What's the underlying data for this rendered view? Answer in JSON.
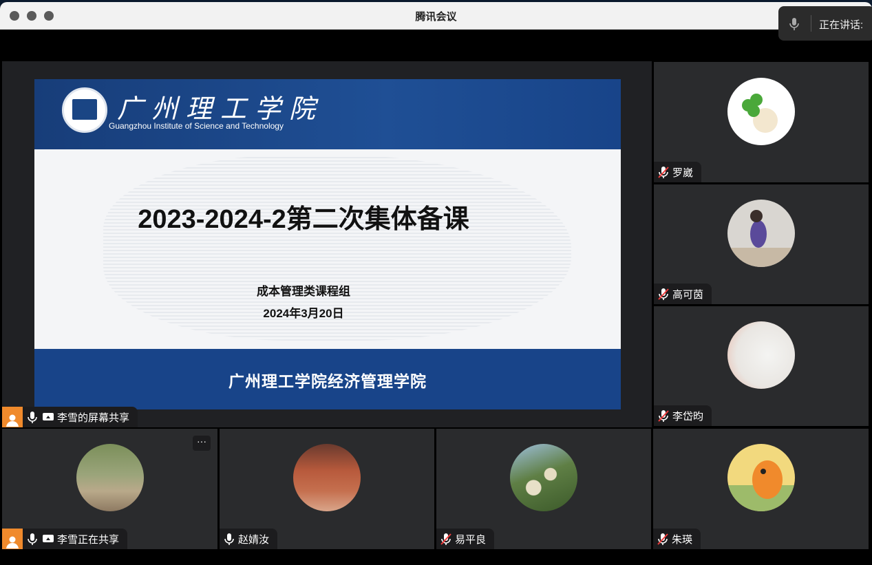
{
  "window": {
    "title": "腾讯会议"
  },
  "speaking_indicator": {
    "label": "正在讲话:"
  },
  "shared_screen": {
    "slide": {
      "school_name_cn": "广州理工学院",
      "school_name_en": "Guangzhou Institute of Science and Technology",
      "title": "2023-2024-2第二次集体备课",
      "subtitle": "成本管理类课程组",
      "date": "2024年3月20日",
      "footer": "广州理工学院经济管理学院"
    },
    "label": "李雪的屏幕共享"
  },
  "participants": [
    {
      "name": "罗崴",
      "mic": "muted",
      "avatar": "clover-bear"
    },
    {
      "name": "高可茵",
      "mic": "muted",
      "avatar": "child-photo"
    },
    {
      "name": "李岱昀",
      "mic": "muted",
      "avatar": "pale-blur"
    },
    {
      "name": "李雪正在共享",
      "mic": "on",
      "avatar": "park-boardwalk",
      "more": "···"
    },
    {
      "name": "赵婧汝",
      "mic": "on",
      "avatar": "brick-wall"
    },
    {
      "name": "易平良",
      "mic": "muted",
      "avatar": "apples-tree"
    },
    {
      "name": "朱瑛",
      "mic": "muted",
      "avatar": "cartoon-dragon"
    }
  ],
  "colors": {
    "accent": "#f08a2c",
    "slide_blue": "#184489",
    "tile_bg": "#2a2b2d"
  }
}
